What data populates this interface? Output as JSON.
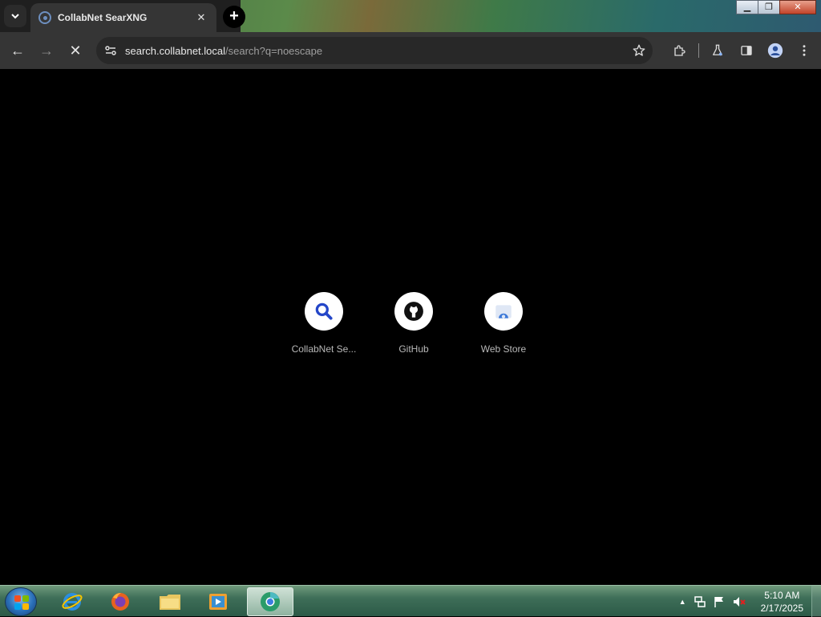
{
  "browser": {
    "tab": {
      "title": "CollabNet SearXNG",
      "close_glyph": "✕"
    },
    "new_tab_glyph": "+",
    "window_controls": {
      "minimize": "▁",
      "maximize": "❐",
      "close": "✕"
    },
    "toolbar": {
      "back_glyph": "←",
      "forward_glyph": "→",
      "stop_glyph": "✕",
      "url_host": "search.collabnet.local",
      "url_path": "/search?q=noescape"
    }
  },
  "shortcuts": [
    {
      "label": "CollabNet Se...",
      "icon": "search-icon"
    },
    {
      "label": "GitHub",
      "icon": "github-icon"
    },
    {
      "label": "Web Store",
      "icon": "webstore-icon"
    }
  ],
  "taskbar": {
    "apps": [
      "internet-explorer",
      "firefox",
      "file-explorer",
      "media-player",
      "chrome"
    ],
    "time": "5:10 AM",
    "date": "2/17/2025",
    "tray_expand_glyph": "▲"
  },
  "colors": {
    "accent": "#8ab4f8",
    "tab_bg": "#353535",
    "content_bg": "#000000"
  }
}
